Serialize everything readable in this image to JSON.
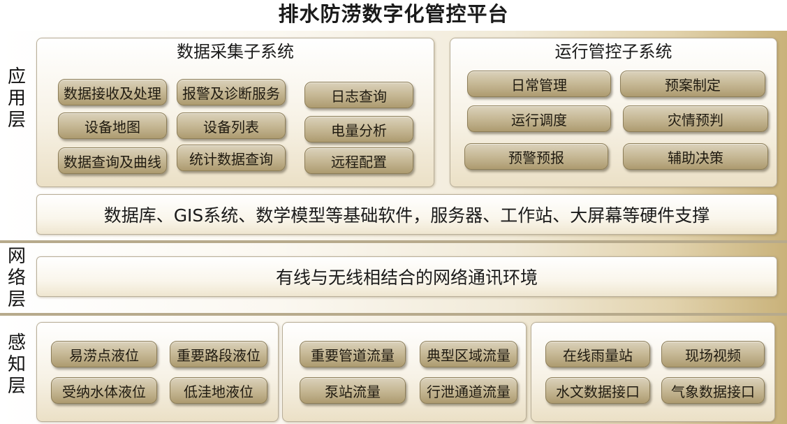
{
  "title": "排水防涝数字化管控平台",
  "layers": {
    "application": {
      "label": [
        "应",
        "用",
        "层"
      ],
      "data_collection": {
        "title": "数据采集子系统",
        "items": [
          "数据接收及处理",
          "报警及诊断服务",
          "日志查询",
          "设备地图",
          "设备列表",
          "电量分析",
          "数据查询及曲线",
          "统计数据查询",
          "远程配置"
        ]
      },
      "operation_control": {
        "title": "运行管控子系统",
        "items": [
          "日常管理",
          "预案制定",
          "运行调度",
          "灾情预判",
          "预警预报",
          "辅助决策"
        ]
      },
      "support": "数据库、GIS系统、数学模型等基础软件，服务器、工作站、大屏幕等硬件支撑"
    },
    "network": {
      "label": [
        "网",
        "络",
        "层"
      ],
      "text": "有线与无线相结合的网络通讯环境"
    },
    "perception": {
      "label": [
        "感",
        "知",
        "层"
      ],
      "group1": [
        "易涝点液位",
        "重要路段液位",
        "受纳水体液位",
        "低洼地液位"
      ],
      "group2": [
        "重要管道流量",
        "典型区域流量",
        "泵站流量",
        "行泄通道流量"
      ],
      "group3": [
        "在线雨量站",
        "现场视频",
        "水文数据接口",
        "气象数据接口"
      ]
    }
  }
}
